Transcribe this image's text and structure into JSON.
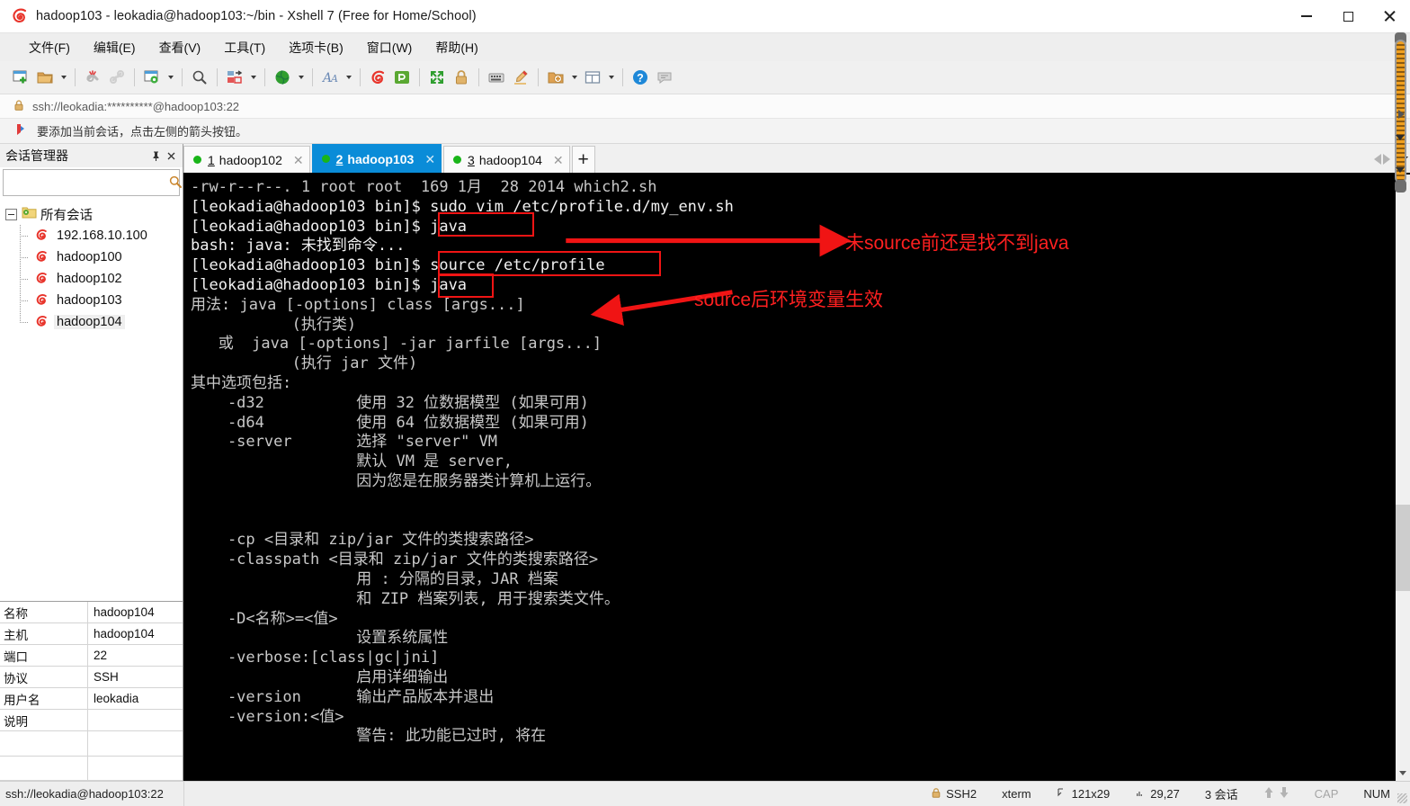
{
  "window": {
    "title": "hadoop103 - leokadia@hadoop103:~/bin - Xshell 7 (Free for Home/School)",
    "app_icon": "xshell-logo-icon",
    "minimize_label": "Minimize",
    "maximize_label": "Maximize",
    "close_label": "Close"
  },
  "menubar": {
    "items": [
      {
        "label": "文件(F)",
        "name": "menu-file"
      },
      {
        "label": "编辑(E)",
        "name": "menu-edit"
      },
      {
        "label": "查看(V)",
        "name": "menu-view"
      },
      {
        "label": "工具(T)",
        "name": "menu-tools"
      },
      {
        "label": "选项卡(B)",
        "name": "menu-tabs"
      },
      {
        "label": "窗口(W)",
        "name": "menu-window"
      },
      {
        "label": "帮助(H)",
        "name": "menu-help"
      }
    ]
  },
  "toolbar": {
    "buttons": [
      {
        "icon": "new-session-icon",
        "caret": false
      },
      {
        "icon": "open-folder-icon",
        "caret": true
      },
      {
        "icon": "disconnect-icon",
        "caret": false
      },
      {
        "icon": "reconnect-icon",
        "caret": false
      },
      {
        "icon": "session-properties-icon",
        "caret": true
      },
      {
        "icon": "find-icon",
        "caret": false
      },
      {
        "icon": "file-transfer-icon",
        "caret": true
      },
      {
        "icon": "globe-icon",
        "caret": true
      },
      {
        "icon": "font-icon",
        "caret": true
      },
      {
        "icon": "xshell-icon",
        "caret": false
      },
      {
        "icon": "xftp-icon",
        "caret": false
      },
      {
        "icon": "fullscreen-icon",
        "caret": false
      },
      {
        "icon": "lock-icon",
        "caret": false
      },
      {
        "icon": "keyboard-icon",
        "caret": false
      },
      {
        "icon": "highlight-pen-icon",
        "caret": false
      },
      {
        "icon": "add-to-folder-icon",
        "caret": true
      },
      {
        "icon": "split-layout-icon",
        "caret": true
      },
      {
        "icon": "help-icon",
        "caret": false
      },
      {
        "icon": "chat-icon",
        "caret": false
      }
    ]
  },
  "addressbar": {
    "lock_icon": "lock-icon",
    "url": "ssh://leokadia:**********@hadoop103:22",
    "go_icon": "arrow-right-icon"
  },
  "tipbar": {
    "icon": "flag-arrow-icon",
    "text": "要添加当前会话，点击左侧的箭头按钮。"
  },
  "sidebar": {
    "title": "会话管理器",
    "pin_icon": "pin-icon",
    "close_icon": "close-icon",
    "search": {
      "value": "",
      "placeholder": "",
      "icon": "search-icon"
    },
    "tree": {
      "root": {
        "label": "所有会话",
        "icon": "folder-gear-icon"
      },
      "nodes": [
        {
          "label": "192.168.10.100",
          "icon": "session-icon",
          "selected": false
        },
        {
          "label": "hadoop100",
          "icon": "session-icon",
          "selected": false
        },
        {
          "label": "hadoop102",
          "icon": "session-icon",
          "selected": false
        },
        {
          "label": "hadoop103",
          "icon": "session-icon",
          "selected": false
        },
        {
          "label": "hadoop104",
          "icon": "session-icon",
          "selected": true
        }
      ]
    },
    "properties": [
      {
        "key": "名称",
        "value": "hadoop104"
      },
      {
        "key": "主机",
        "value": "hadoop104"
      },
      {
        "key": "端口",
        "value": "22"
      },
      {
        "key": "协议",
        "value": "SSH"
      },
      {
        "key": "用户名",
        "value": "leokadia"
      },
      {
        "key": "说明",
        "value": ""
      }
    ]
  },
  "tabs": {
    "items": [
      {
        "num": "1",
        "label": "hadoop102",
        "active": false,
        "status": "connected",
        "close_icon": "close-icon"
      },
      {
        "num": "2",
        "label": "hadoop103",
        "active": true,
        "status": "connected",
        "close_icon": "close-icon"
      },
      {
        "num": "3",
        "label": "hadoop104",
        "active": false,
        "status": "connected",
        "close_icon": "close-icon"
      }
    ],
    "add_label": "+",
    "nav_left_icon": "chevron-left-icon",
    "nav_right_icon": "chevron-right-icon",
    "nav_menu_icon": "chevron-down-icon"
  },
  "terminal": {
    "lines": [
      "-rw-r--r--. 1 root root  169 1月  28 2014 which2.sh",
      "[leokadia@hadoop103 bin]$ sudo vim /etc/profile.d/my_env.sh",
      "[leokadia@hadoop103 bin]$ java",
      "bash: java: 未找到命令...",
      "[leokadia@hadoop103 bin]$ source /etc/profile",
      "[leokadia@hadoop103 bin]$ java",
      "用法: java [-options] class [args...]",
      "           (执行类)",
      "   或  java [-options] -jar jarfile [args...]",
      "           (执行 jar 文件)",
      "其中选项包括:",
      "    -d32          使用 32 位数据模型 (如果可用)",
      "    -d64          使用 64 位数据模型 (如果可用)",
      "    -server       选择 \"server\" VM",
      "                  默认 VM 是 server,",
      "                  因为您是在服务器类计算机上运行。",
      "",
      "",
      "    -cp <目录和 zip/jar 文件的类搜索路径>",
      "    -classpath <目录和 zip/jar 文件的类搜索路径>",
      "                  用 : 分隔的目录，JAR 档案",
      "                  和 ZIP 档案列表, 用于搜索类文件。",
      "    -D<名称>=<值>",
      "                  设置系统属性",
      "    -verbose:[class|gc|jni]",
      "                  启用详细输出",
      "    -version      输出产品版本并退出",
      "    -version:<值>",
      "                  警告: 此功能已过时, 将在"
    ],
    "scrollbar": {
      "up_icon": "caret-up-icon",
      "down_icon": "caret-down-icon"
    }
  },
  "annotations": {
    "color": "#ff2020",
    "boxes": [
      {
        "name": "highlight-java-first",
        "target": "java"
      },
      {
        "name": "highlight-source-profile",
        "target": "source /etc/profile"
      },
      {
        "name": "highlight-java-second",
        "target": "java"
      }
    ],
    "notes": [
      {
        "name": "note-before-source",
        "text": "未source前还是找不到java"
      },
      {
        "name": "note-after-source",
        "text": "source后环境变量生效"
      }
    ]
  },
  "statusbar": {
    "connection": "ssh://leokadia@hadoop103:22",
    "protocol": "SSH2",
    "protocol_icon": "lock-icon",
    "term_type": "xterm",
    "size_icon": "resize-icon",
    "size": "121x29",
    "cursor_icon": "cursor-icon",
    "cursor": "29,27",
    "sessions": "3 会话",
    "up_icon": "arrow-up-icon",
    "down_icon": "arrow-down-icon",
    "cap": "CAP",
    "num": "NUM"
  }
}
